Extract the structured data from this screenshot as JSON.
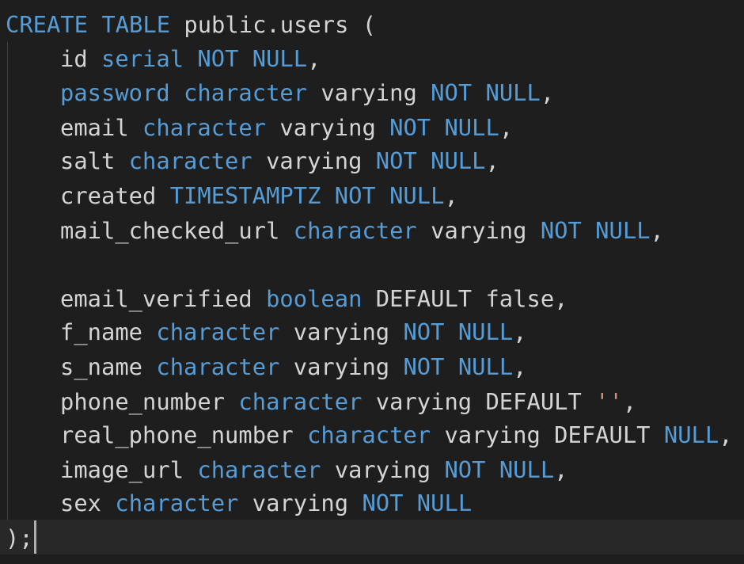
{
  "colors": {
    "background": "#1e1e1e",
    "keyword": "#569cd6",
    "text": "#d4d4d4",
    "string": "#ce9178",
    "cursor": "#aeafad"
  },
  "code": {
    "line1": {
      "kw": "CREATE TABLE",
      "rest": " public.users ("
    },
    "id": {
      "name": "id ",
      "type": "serial",
      "c1": " ",
      "nn": "NOT NULL",
      "end": ","
    },
    "password": {
      "name": "password",
      "sp": " ",
      "type": "character",
      "mid": " varying ",
      "nn": "NOT NULL",
      "end": ","
    },
    "email": {
      "name": "email ",
      "type": "character",
      "mid": " varying ",
      "nn": "NOT NULL",
      "end": ","
    },
    "salt": {
      "name": "salt ",
      "type": "character",
      "mid": " varying ",
      "nn": "NOT NULL",
      "end": ","
    },
    "created": {
      "name": "created ",
      "type": "TIMESTAMPTZ NOT NULL",
      "end": ","
    },
    "mail_checked_url": {
      "name": "mail_checked_url ",
      "type": "character",
      "mid": " varying ",
      "nn": "NOT NULL",
      "end": ","
    },
    "email_verified": {
      "name": "email_verified ",
      "type": "boolean",
      "rest": " DEFAULT false,"
    },
    "f_name": {
      "name": "f_name ",
      "type": "character",
      "mid": " varying ",
      "nn": "NOT NULL",
      "end": ","
    },
    "s_name": {
      "name": "s_name ",
      "type": "character",
      "mid": " varying ",
      "nn": "NOT NULL",
      "end": ","
    },
    "phone_number": {
      "name": "phone_number ",
      "type": "character",
      "mid": " varying DEFAULT ",
      "str": "''",
      "end": ","
    },
    "real_phone_number": {
      "name": "real_phone_number ",
      "type": "character",
      "mid": " varying DEFAULT ",
      "nn": "NULL",
      "end": ","
    },
    "image_url": {
      "name": "image_url ",
      "type": "character",
      "mid": " varying ",
      "nn": "NOT NULL",
      "end": ","
    },
    "sex": {
      "name": "sex ",
      "type": "character",
      "mid": " varying ",
      "nn": "NOT NULL"
    },
    "close": {
      "text": ");"
    }
  }
}
